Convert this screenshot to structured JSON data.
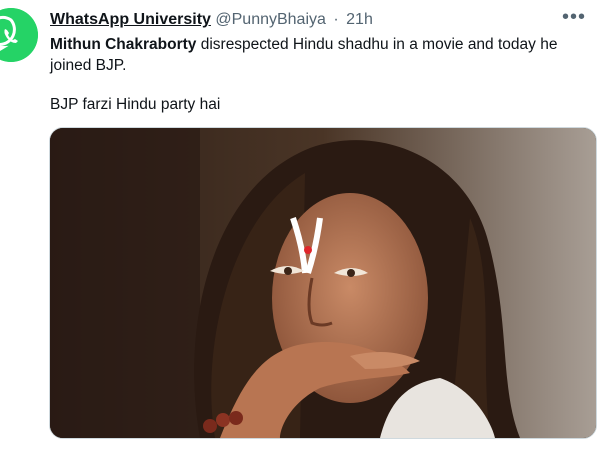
{
  "tweet": {
    "author_name": "WhatsApp University",
    "handle": "@PunnyBhaiya",
    "separator": "·",
    "time": "21h",
    "more_label": "•••",
    "mention_name": "Mithun Chakraborty",
    "text_line1": " disrespected Hindu shadhu in a movie and today he joined BJP.",
    "text_line2": "BJP farzi Hindu party hai"
  },
  "icons": {
    "avatar": "whatsapp-logo-icon",
    "more": "more-options-icon"
  },
  "colors": {
    "avatar_bg": "#25d366",
    "text": "#0f1419",
    "muted": "#536471",
    "media_border": "#cfd9de"
  }
}
